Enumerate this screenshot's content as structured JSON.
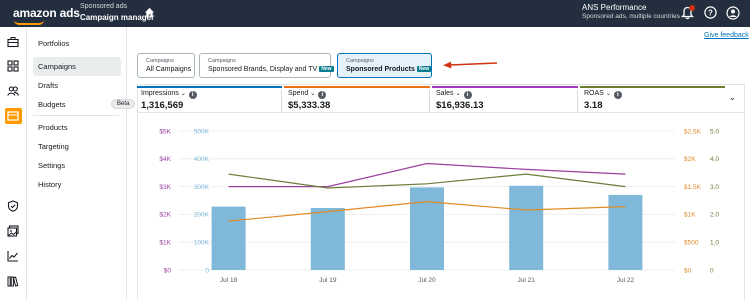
{
  "header": {
    "logo": "amazon ads",
    "app_subtitle": "Sponsored ads",
    "app_title": "Campaign manager",
    "account_name": "ANS Performance",
    "account_sub": "Sponsored ads, multiple countries"
  },
  "sidebar": {
    "items": [
      {
        "label": "Portfolios"
      },
      {
        "label": "Campaigns",
        "active": true
      },
      {
        "label": "Drafts"
      },
      {
        "label": "Budgets",
        "badge": "Beta"
      },
      {
        "label": "Products"
      },
      {
        "label": "Targeting"
      },
      {
        "label": "Settings"
      },
      {
        "label": "History"
      }
    ]
  },
  "feedback_link": "Give feedback",
  "campaign_cards": [
    {
      "caption": "Campaigns",
      "label": "All Campaigns"
    },
    {
      "caption": "Campaigns",
      "label": "Sponsored Brands, Display and TV",
      "badge": "New"
    },
    {
      "caption": "Campaigns",
      "label": "Sponsored Products",
      "badge": "New",
      "selected": true
    }
  ],
  "metrics": [
    {
      "label": "Impressions",
      "value": "1,316,569",
      "color": "#0073bb"
    },
    {
      "label": "Spend",
      "value": "$5,333.38",
      "color": "#ec7211"
    },
    {
      "label": "Sales",
      "value": "$16,936.13",
      "color": "#a23abb"
    },
    {
      "label": "ROAS",
      "value": "3.18",
      "color": "#6b7d2e"
    }
  ],
  "colors": {
    "impressions": "#7fb8d8",
    "spend": "#e08a26",
    "sales": "#9b3fa0",
    "roas": "#6b7d3a",
    "arrow": "#d13212"
  },
  "chart_data": {
    "type": "bar",
    "categories": [
      "Jul 18",
      "Jul 19",
      "Jul 20",
      "Jul 21",
      "Jul 22"
    ],
    "y_sales_ticks": [
      "$0",
      "$1K",
      "$2K",
      "$3K",
      "$4K",
      "$5K"
    ],
    "y_impr_ticks": [
      "0",
      "100K",
      "200K",
      "300K",
      "400K",
      "500K"
    ],
    "y_spend_ticks": [
      "$0",
      "$500",
      "$1K",
      "$1.5K",
      "$2K",
      "$2.5K"
    ],
    "y_roas_ticks": [
      "0",
      "1.0",
      "2.0",
      "3.0",
      "4.0",
      "5.0"
    ],
    "series": [
      {
        "name": "Impressions",
        "values": [
          228000,
          223000,
          297000,
          303000,
          270000
        ],
        "ylim": [
          0,
          500000
        ]
      },
      {
        "name": "Spend",
        "values": [
          880,
          1050,
          1230,
          1080,
          1140
        ],
        "ylim": [
          0,
          2500
        ]
      },
      {
        "name": "Sales",
        "values": [
          3000,
          3000,
          3830,
          3620,
          3450
        ],
        "ylim": [
          0,
          5000
        ]
      },
      {
        "name": "ROAS",
        "values": [
          3.45,
          2.95,
          3.1,
          3.45,
          3.0
        ],
        "ylim": [
          0,
          5
        ]
      }
    ]
  }
}
